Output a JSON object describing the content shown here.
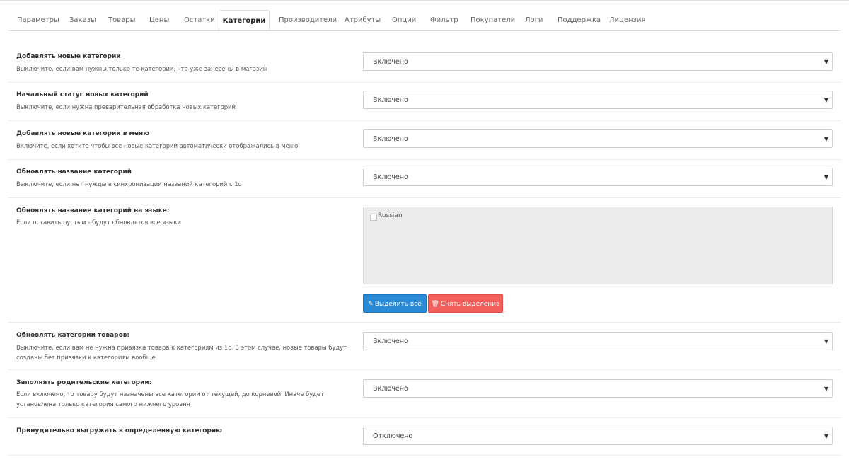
{
  "tabs": [
    {
      "label": "Параметры"
    },
    {
      "label": "Заказы"
    },
    {
      "label": "Товары"
    },
    {
      "label": "Цены"
    },
    {
      "label": "Остатки"
    },
    {
      "label": "Категории"
    },
    {
      "label": "Производители"
    },
    {
      "label": "Атрибуты"
    },
    {
      "label": "Опции"
    },
    {
      "label": "Фильтр"
    },
    {
      "label": "Покупатели"
    },
    {
      "label": "Логи"
    },
    {
      "label": "Поддержка"
    },
    {
      "label": "Лицензия"
    }
  ],
  "active_tab": "Категории",
  "settings": {
    "add_new": {
      "label": "Добавлять новые категории",
      "help": "Выключите, если вам нужны только те категории, что уже занесены в магазин",
      "value": "Включено"
    },
    "new_status": {
      "label": "Начальный статус новых категорий",
      "help": "Выключите, если нужна преварительная обработка новых категорий",
      "value": "Включено"
    },
    "add_menu": {
      "label": "Добавлять новые категории в меню",
      "help": "Включите, если хотите чтобы все новые категории автоматически отображались в меню",
      "value": "Включено"
    },
    "update_name": {
      "label": "Обновлять название категорий",
      "help": "Выключите, если нет нужды в синхронизации названий категорий с 1с",
      "value": "Включено"
    },
    "update_name_lang": {
      "label": "Обновлять название категорий на языке:",
      "help": "Если оставить пустым - будут обновлятся все языки",
      "languages": [
        {
          "label": "Russian",
          "checked": false
        }
      ]
    },
    "update_product_cats": {
      "label": "Обновлять категории товаров:",
      "help": "Выключите, если вам не нужна привязка товара к категориям из 1с. В этом случае, новые товары будут созданы без привязки к категориям вообще",
      "value": "Включено"
    },
    "fill_parent": {
      "label": "Заполнять родительские категории:",
      "help": "Если включено, то товару будут назначены все категории от текущей, до корневой. Иначе будет установлена только категория самого нижнего уровня",
      "value": "Включено"
    },
    "force_category": {
      "label": "Принудительно выгружать в определенную категорию",
      "value": "Отключено"
    }
  },
  "buttons": {
    "select_all": "Выделить всё",
    "deselect": "Снять выделение"
  },
  "icons": {
    "select_all": "pencil-icon",
    "deselect": "trash-icon",
    "dropdown": "caret-down-icon"
  },
  "colors": {
    "select_all_bg": "#2a8ad6",
    "deselect_bg": "#f1605a"
  }
}
